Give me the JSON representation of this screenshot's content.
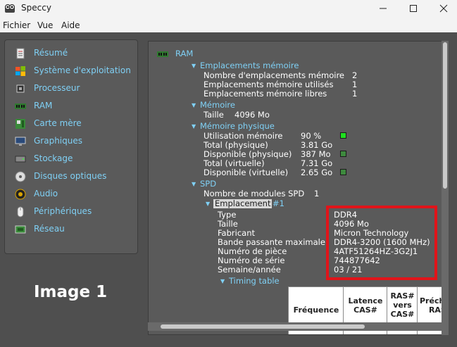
{
  "window": {
    "title": "Speccy"
  },
  "menu": {
    "items": [
      "Fichier",
      "Vue",
      "Aide"
    ]
  },
  "sidebar": {
    "items": [
      {
        "label": "Résumé",
        "icon": "summary-icon"
      },
      {
        "label": "Système d'exploitation",
        "icon": "windows-icon"
      },
      {
        "label": "Processeur",
        "icon": "cpu-icon"
      },
      {
        "label": "RAM",
        "icon": "ram-icon"
      },
      {
        "label": "Carte mère",
        "icon": "motherboard-icon"
      },
      {
        "label": "Graphiques",
        "icon": "monitor-icon"
      },
      {
        "label": "Stockage",
        "icon": "storage-icon"
      },
      {
        "label": "Disques optiques",
        "icon": "disc-icon"
      },
      {
        "label": "Audio",
        "icon": "speaker-icon"
      },
      {
        "label": "Périphériques",
        "icon": "mouse-icon"
      },
      {
        "label": "Réseau",
        "icon": "network-icon"
      }
    ]
  },
  "annotation": {
    "label": "Image 1"
  },
  "content": {
    "title": "RAM",
    "slots": {
      "header": "Emplacements mémoire",
      "rows": [
        {
          "label": "Nombre d'emplacements mémoire",
          "value": "2"
        },
        {
          "label": "Emplacements mémoire utilisés",
          "value": "1"
        },
        {
          "label": "Emplacements mémoire libres",
          "value": "1"
        }
      ]
    },
    "memory": {
      "header": "Mémoire",
      "size_label": "Taille",
      "size_value": "4096 Mo"
    },
    "physical": {
      "header": "Mémoire physique",
      "rows": [
        {
          "label": "Utilisation mémoire",
          "value": "90 %"
        },
        {
          "label": "Total (physique)",
          "value": "3.81 Go"
        },
        {
          "label": "Disponible (physique)",
          "value": "387 Mo"
        },
        {
          "label": "Total (virtuelle)",
          "value": "7.31 Go"
        },
        {
          "label": "Disponible (virtuelle)",
          "value": "2.65 Go"
        }
      ]
    },
    "spd": {
      "header": "SPD",
      "modules_label": "Nombre de modules SPD",
      "modules_value": "1",
      "slot_label": "Emplacement",
      "slot_num": "#1",
      "rows": [
        {
          "label": "Type",
          "value": "DDR4"
        },
        {
          "label": "Taille",
          "value": "4096 Mo"
        },
        {
          "label": "Fabricant",
          "value": "Micron Technology"
        },
        {
          "label": "Bande passante maximale",
          "value": "DDR4-3200 (1600 MHz)"
        },
        {
          "label": "Numéro de pièce",
          "value": "4ATF51264HZ-3G2J1"
        },
        {
          "label": "Numéro de série",
          "value": "744877642"
        },
        {
          "label": "Semaine/année",
          "value": "03 / 21"
        }
      ],
      "timing_header": "Timing table",
      "table_headers": {
        "freq": "Fréquence",
        "latency": [
          "Latence",
          "CAS#"
        ],
        "ras": [
          "RAS#",
          "vers",
          "CAS#"
        ],
        "pre": [
          "Précharge",
          "RAS#"
        ]
      }
    }
  }
}
